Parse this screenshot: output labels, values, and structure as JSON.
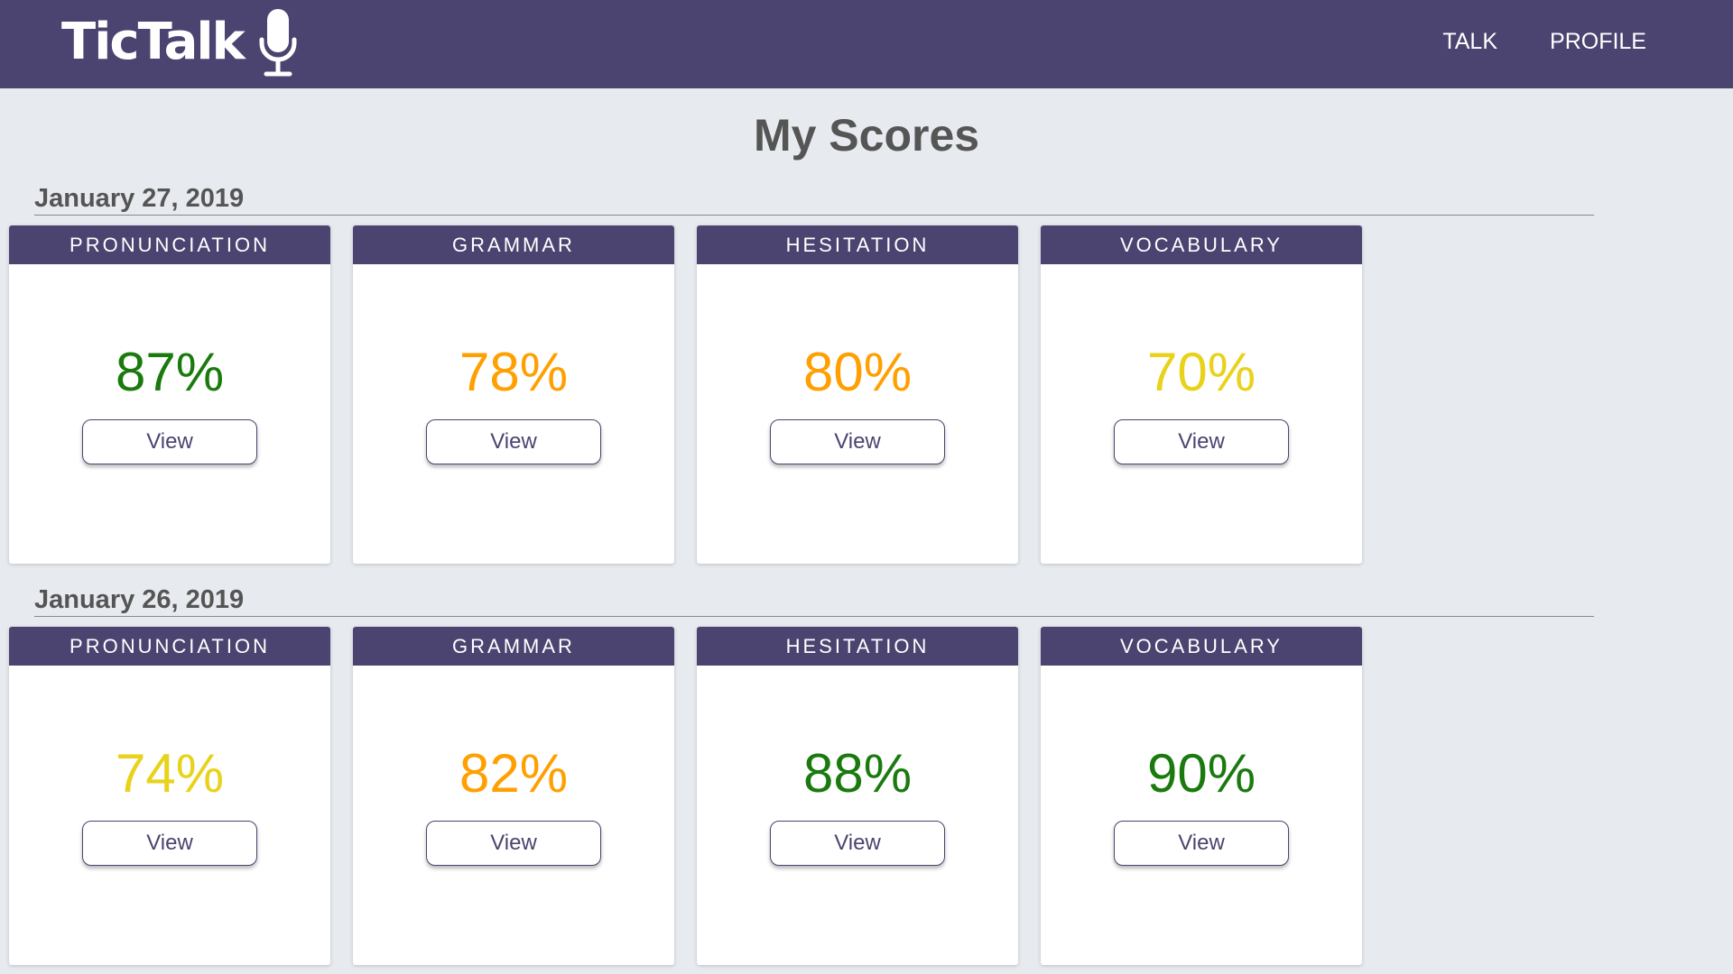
{
  "app": {
    "logo_text": "TicTalk",
    "nav": [
      {
        "label": "TALK"
      },
      {
        "label": "PROFILE"
      }
    ]
  },
  "page": {
    "title": "My Scores"
  },
  "colors": {
    "brand": "#4b4470",
    "background": "#e7eaef",
    "score_green": "#1a7a0e",
    "score_orange": "#ff9f00",
    "score_yellow": "#e8d21a"
  },
  "sessions": [
    {
      "date": "January 27, 2019",
      "scores": [
        {
          "category": "PRONUNCIATION",
          "value": "87%",
          "color": "#1a7a0e",
          "button": "View"
        },
        {
          "category": "GRAMMAR",
          "value": "78%",
          "color": "#ff9f00",
          "button": "View"
        },
        {
          "category": "HESITATION",
          "value": "80%",
          "color": "#ff9f00",
          "button": "View"
        },
        {
          "category": "VOCABULARY",
          "value": "70%",
          "color": "#e8d21a",
          "button": "View"
        }
      ]
    },
    {
      "date": "January 26, 2019",
      "scores": [
        {
          "category": "PRONUNCIATION",
          "value": "74%",
          "color": "#e8d21a",
          "button": "View"
        },
        {
          "category": "GRAMMAR",
          "value": "82%",
          "color": "#ff9f00",
          "button": "View"
        },
        {
          "category": "HESITATION",
          "value": "88%",
          "color": "#1a7a0e",
          "button": "View"
        },
        {
          "category": "VOCABULARY",
          "value": "90%",
          "color": "#1a7a0e",
          "button": "View"
        }
      ]
    }
  ]
}
